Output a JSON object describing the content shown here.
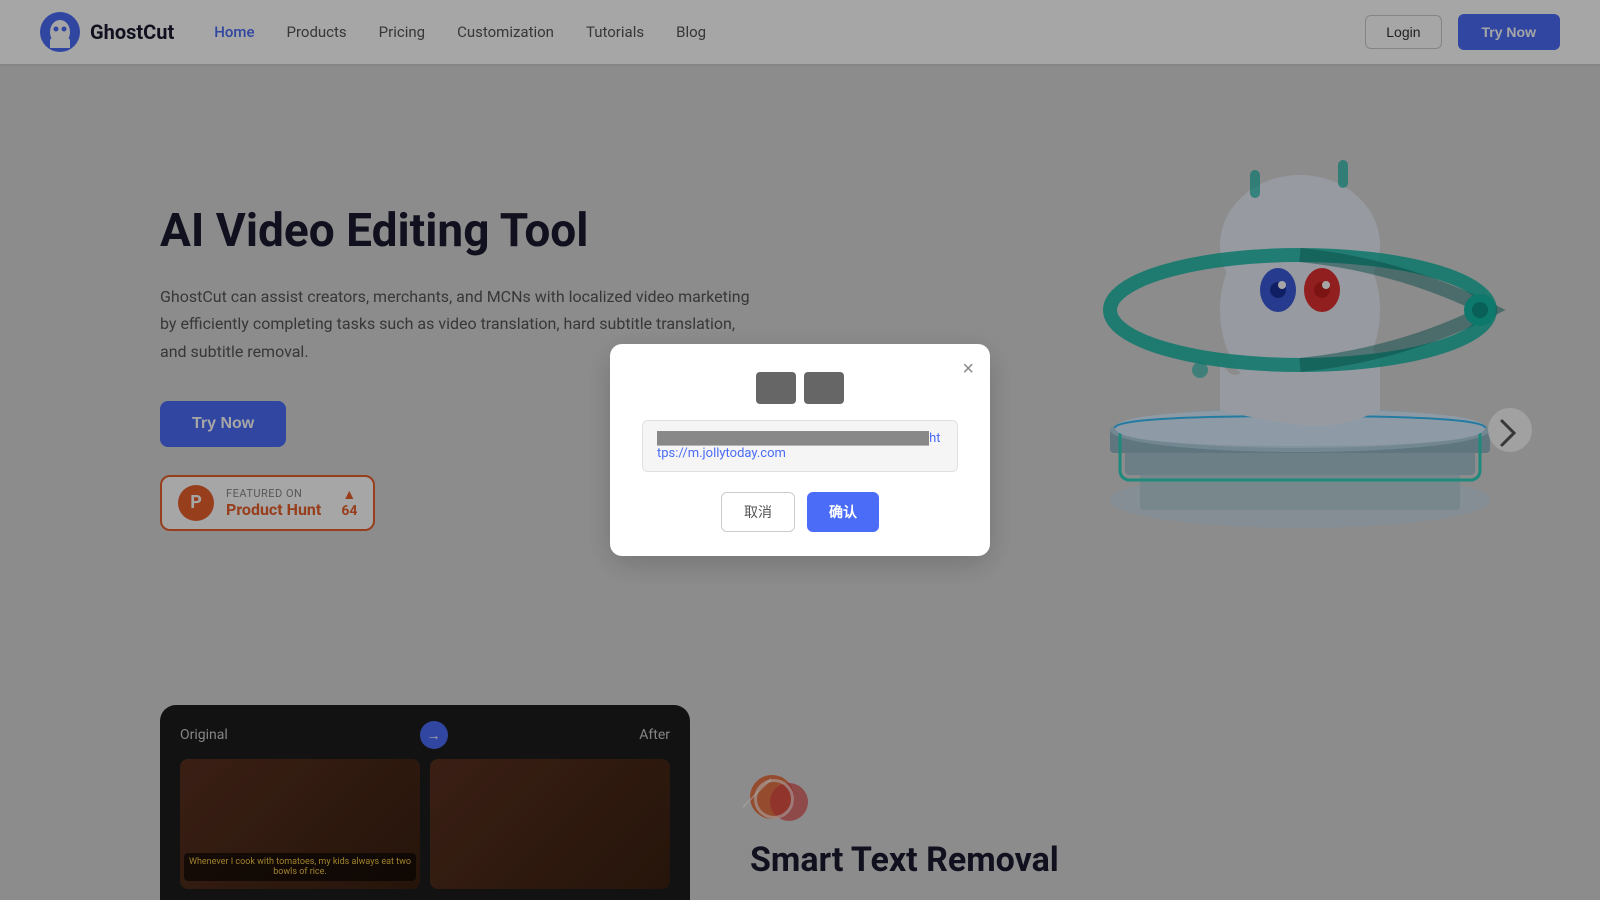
{
  "navbar": {
    "logo_text": "GhostCut",
    "nav_items": [
      {
        "label": "Home",
        "active": true
      },
      {
        "label": "Products",
        "active": false
      },
      {
        "label": "Pricing",
        "active": false
      },
      {
        "label": "Customization",
        "active": false
      },
      {
        "label": "Tutorials",
        "active": false
      },
      {
        "label": "Blog",
        "active": false
      }
    ],
    "login_label": "Login",
    "try_now_label": "Try Now"
  },
  "hero": {
    "title": "AI Video Editing Tool",
    "description": "GhostCut can assist creators, merchants, and MCNs with localized video marketing by efficiently completing tasks such as video translation, hard subtitle translation, and subtitle removal.",
    "try_now_label": "Try Now",
    "product_hunt": {
      "featured_label": "FEATURED ON",
      "name": "Product Hunt",
      "count": "64",
      "arrow": "▲"
    }
  },
  "bottom": {
    "comparison": {
      "original_label": "Original",
      "after_label": "After",
      "subtitle": "Whenever I cook with tomatoes, my kids always eat two bowls of rice."
    },
    "smart_text": {
      "title": "Smart Text Removal"
    }
  },
  "modal": {
    "close_label": "×",
    "url_prefix": "████████████████████████████████",
    "url_link": "https://m.jollytoday.com",
    "cancel_label": "取消",
    "confirm_label": "确认"
  }
}
